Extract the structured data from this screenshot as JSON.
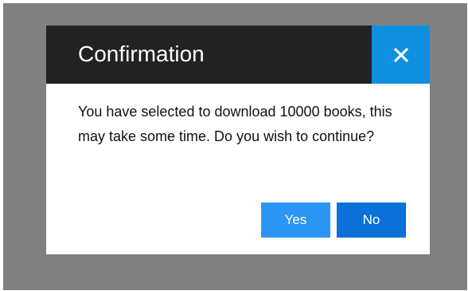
{
  "dialog": {
    "title": "Confirmation",
    "close_icon": "close-icon",
    "message": "You have selected to download 10000 books, this may take some time. Do you wish to continue?",
    "yes_label": "Yes",
    "no_label": "No"
  },
  "colors": {
    "overlay": "#808080",
    "header_bg": "#222222",
    "close_bg": "#0f90df",
    "yes_bg": "#2b95f3",
    "no_bg": "#0a71d8"
  }
}
